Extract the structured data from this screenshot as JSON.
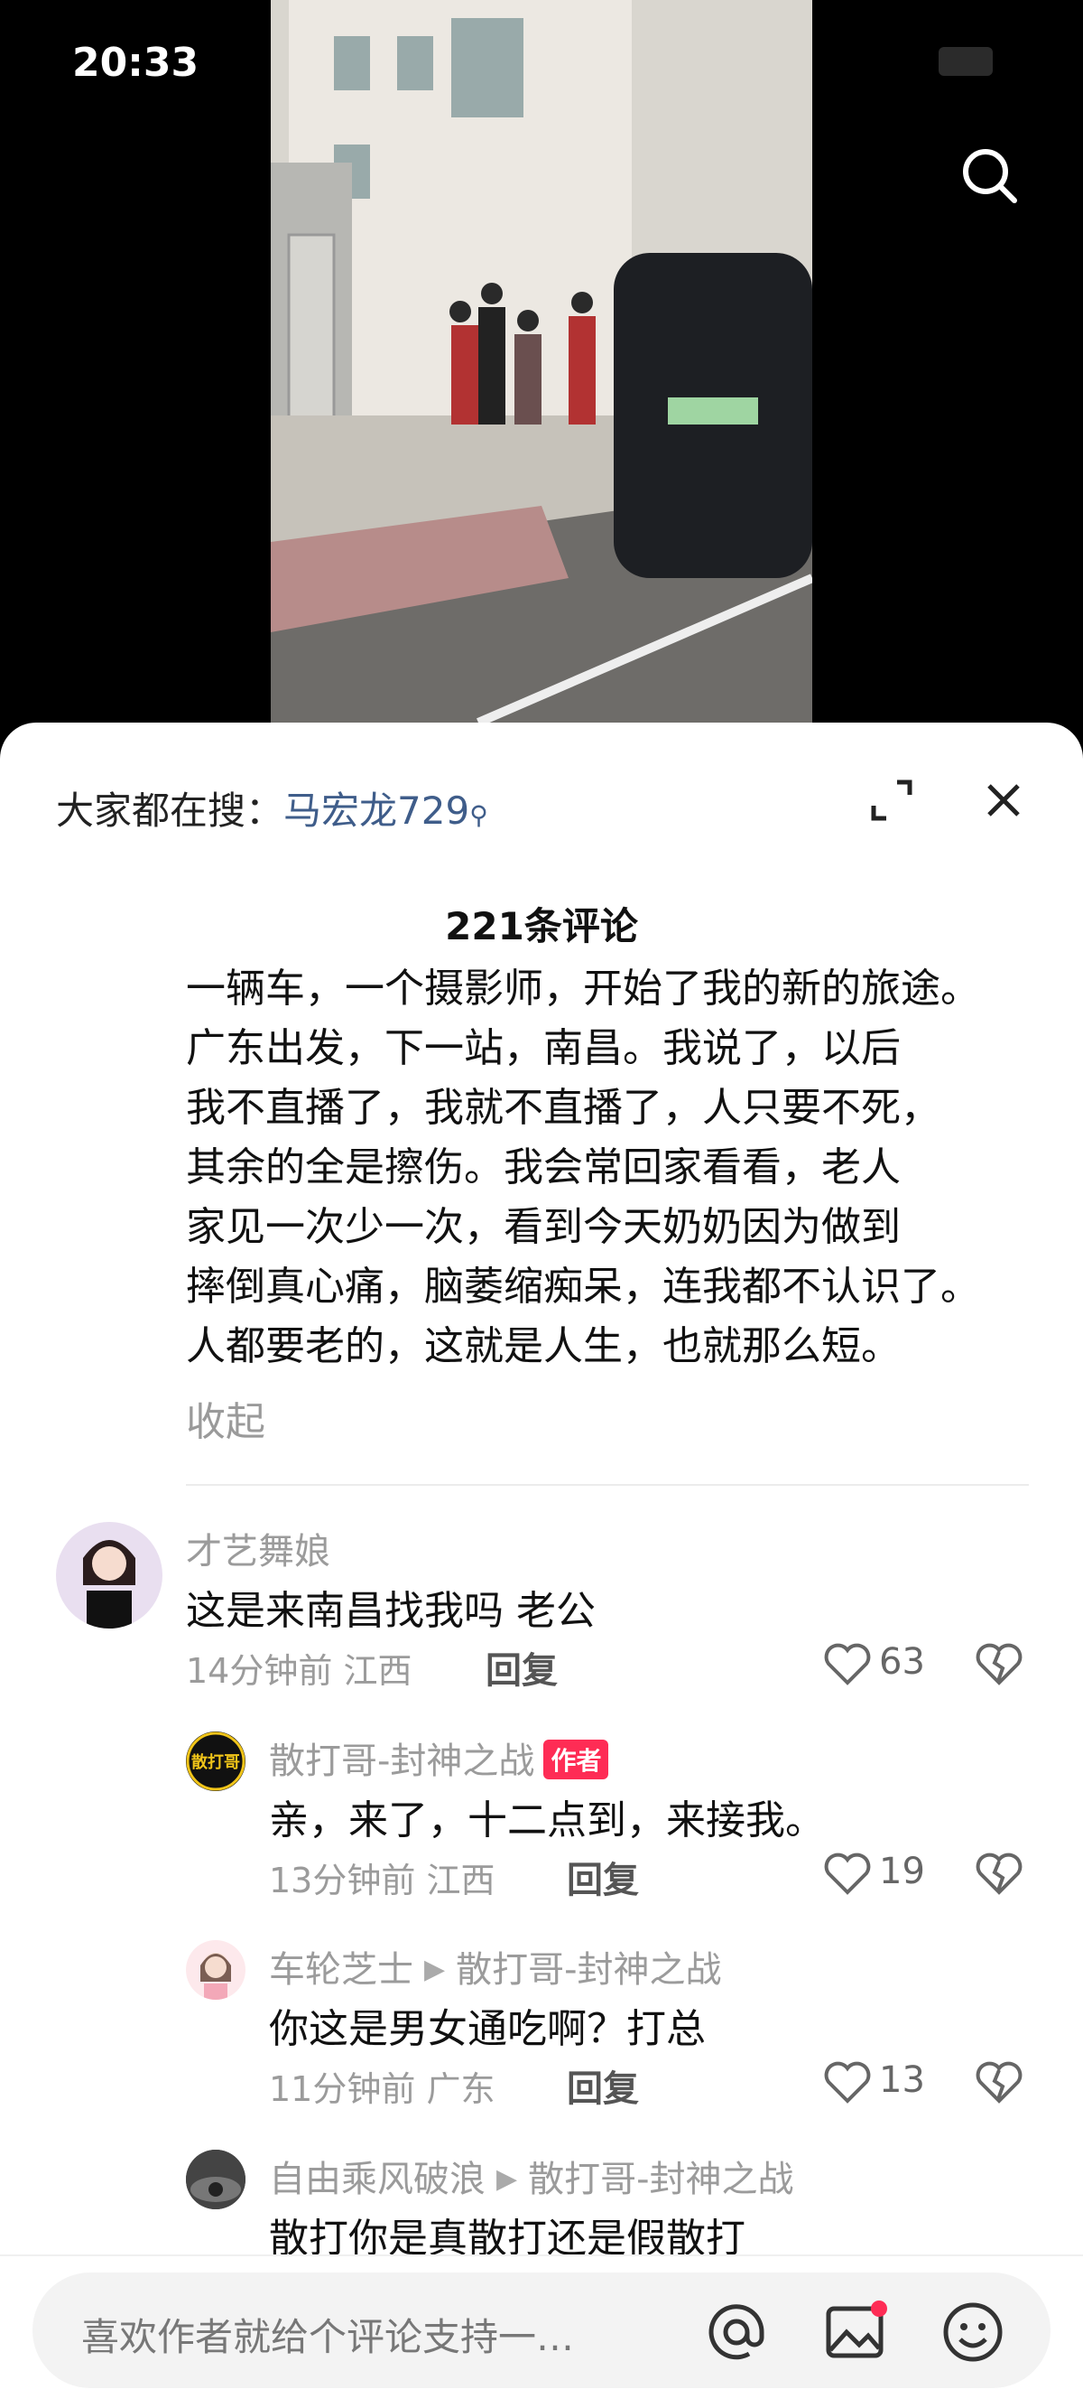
{
  "status": {
    "time": "20:33"
  },
  "sheet": {
    "trending_prefix": "大家都在搜：",
    "trending_query": "马宏龙729",
    "comment_count": "221条评论",
    "description": "一辆车，一个摄影师，开始了我的新的旅途。\n广东出发，下一站，南昌。我说了，以后\n我不直播了，我就不直播了，人只要不死，\n其余的全是擦伤。我会常回家看看，老人\n家见一次少一次，看到今天奶奶因为做到\n摔倒真心痛，脑萎缩痴呆，连我都不认识了。\n人都要老的，这就是人生，也就那么短。",
    "collapse": "收起"
  },
  "comments": [
    {
      "user": "才艺舞娘",
      "text": "这是来南昌找我吗 老公",
      "time": "14分钟前",
      "loc": "江西",
      "reply": "回复",
      "likes": "63"
    },
    {
      "user": "散打哥-封神之战",
      "badge": "作者",
      "text": "亲，来了，十二点到，来接我。",
      "time": "13分钟前",
      "loc": "江西",
      "reply": "回复",
      "likes": "19",
      "avatar_text": "散打哥"
    },
    {
      "user": "车轮芝士",
      "reply_to": "散打哥-封神之战",
      "text": "你这是男女通吃啊？打总",
      "time": "11分钟前",
      "loc": "广东",
      "reply": "回复",
      "likes": "13"
    },
    {
      "user": "自由乘风破浪",
      "reply_to": "散打哥-封神之战",
      "text": "散打你是真散打还是假散打"
    }
  ],
  "input": {
    "placeholder": "喜欢作者就给个评论支持一…"
  },
  "icons": [
    "search-icon",
    "expand-icon",
    "close-icon",
    "heart-icon",
    "broken-heart-icon",
    "at-icon",
    "image-icon",
    "emoji-icon"
  ],
  "colors": {
    "accent": "#fe2c55",
    "link": "#3f5d8a"
  }
}
